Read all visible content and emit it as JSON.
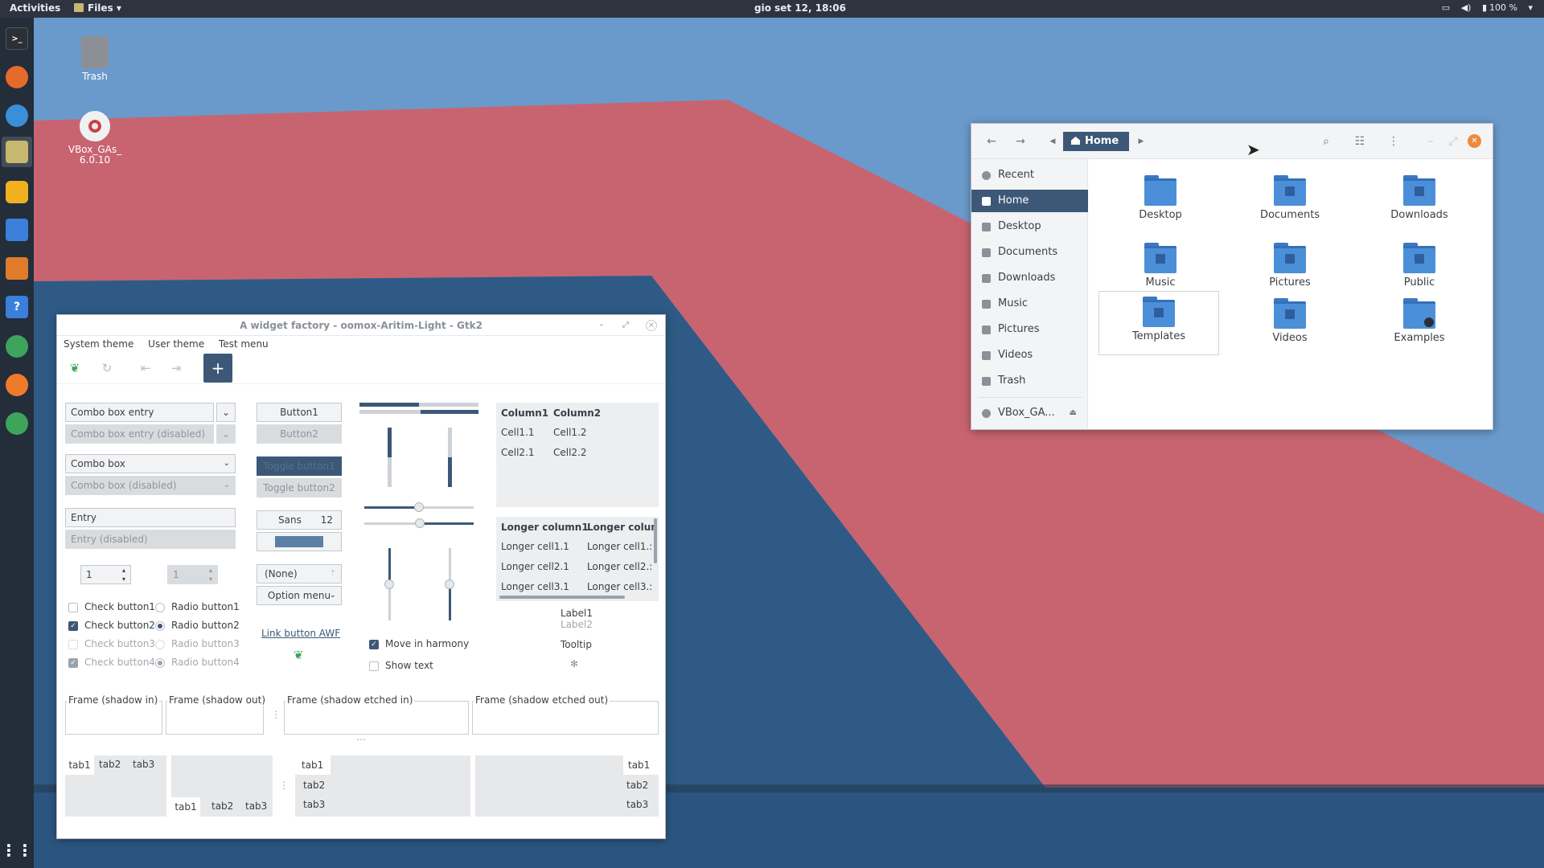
{
  "topbar": {
    "activities": "Activities",
    "app_menu": "Files",
    "clock": "gio set 12, 18:06",
    "battery": "100 %"
  },
  "desktop": {
    "trash_label": "Trash",
    "vbox_label": "VBox_GAs_\n6.0.10",
    "vbox_line1": "VBox_GAs_",
    "vbox_line2": "6.0.10"
  },
  "widget_factory": {
    "title": "A widget factory - oomox-Aritim-Light - Gtk2",
    "menu": [
      "System theme",
      "User theme",
      "Test menu"
    ],
    "combo_entry": "Combo box entry",
    "combo_entry_disabled": "Combo box entry (disabled)",
    "combo_box": "Combo box",
    "combo_box_disabled": "Combo box (disabled)",
    "entry": "Entry",
    "entry_disabled": "Entry (disabled)",
    "spin1": "1",
    "spin2": "1",
    "checks": [
      "Check button1",
      "Check button2",
      "Check button3",
      "Check button4"
    ],
    "radios": [
      "Radio button1",
      "Radio button2",
      "Radio button3",
      "Radio button4"
    ],
    "button1": "Button1",
    "button2": "Button2",
    "toggle1": "Toggle button1",
    "toggle2": "Toggle button2",
    "font_name": "Sans",
    "font_size": "12",
    "file_none": "(None)",
    "option_menu": "Option menu",
    "link_button": "Link button AWF",
    "move_in_harmony": "Move in harmony",
    "show_text": "Show text",
    "tree1": {
      "headers": [
        "Column1",
        "Column2"
      ],
      "rows": [
        [
          "Cell1.1",
          "Cell1.2"
        ],
        [
          "Cell2.1",
          "Cell2.2"
        ]
      ]
    },
    "tree2": {
      "headers": [
        "Longer column1",
        "Longer colun"
      ],
      "rows": [
        [
          "Longer cell1.1",
          "Longer cell1.:"
        ],
        [
          "Longer cell2.1",
          "Longer cell2.:"
        ],
        [
          "Longer cell3.1",
          "Longer cell3.:"
        ]
      ]
    },
    "label1": "Label1",
    "label2": "Label2",
    "tooltip": "Tooltip",
    "frames": [
      "Frame (shadow in)",
      "Frame (shadow out)",
      "Frame (shadow etched in)",
      "Frame (shadow etched out)"
    ],
    "tabs": [
      "tab1",
      "tab2",
      "tab3"
    ]
  },
  "files": {
    "breadcrumb": "Home",
    "sidebar": [
      "Recent",
      "Home",
      "Desktop",
      "Documents",
      "Downloads",
      "Music",
      "Pictures",
      "Videos",
      "Trash",
      "VBox_GA..."
    ],
    "folders": [
      "Desktop",
      "Documents",
      "Downloads",
      "Music",
      "Pictures",
      "Public",
      "Templates",
      "Videos",
      "Examples"
    ]
  },
  "colors": {
    "accent": "#3c5876",
    "wall_blue": "#6b9bc9",
    "wall_red": "#c86470",
    "wall_dark": "#2f5a86"
  }
}
